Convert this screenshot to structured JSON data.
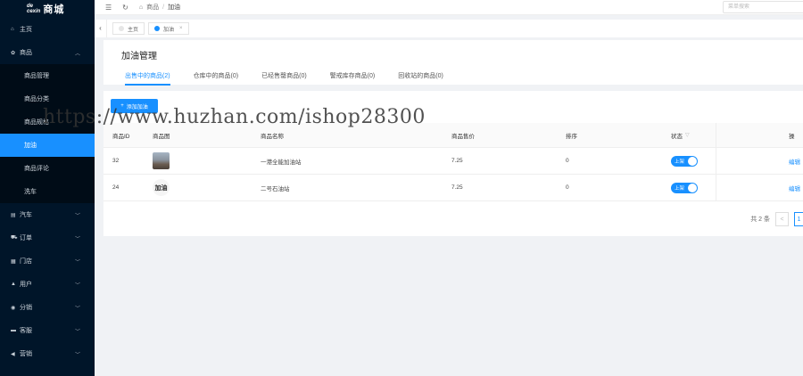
{
  "brand": {
    "mark_top": "de",
    "mark_bottom": "cexin",
    "name": "商城"
  },
  "sidebar": {
    "items": [
      {
        "icon": "home-icon",
        "glyph": "⌂",
        "label": "主页"
      },
      {
        "icon": "goods-icon",
        "glyph": "✿",
        "label": "商品",
        "open": true,
        "children": [
          "商品管理",
          "商品分类",
          "商品规格",
          "加油",
          "商品评论",
          "洗车"
        ],
        "active_child": 3
      },
      {
        "icon": "car-icon",
        "glyph": "▤",
        "label": "汽车"
      },
      {
        "icon": "cart-icon",
        "glyph": "⛟",
        "label": "订单"
      },
      {
        "icon": "store-icon",
        "glyph": "▦",
        "label": "门店"
      },
      {
        "icon": "user-icon",
        "glyph": "▲",
        "label": "用户"
      },
      {
        "icon": "share-icon",
        "glyph": "◉",
        "label": "分销"
      },
      {
        "icon": "chat-icon",
        "glyph": "▬",
        "label": "客服"
      },
      {
        "icon": "send-icon",
        "glyph": "◀",
        "label": "营销"
      }
    ]
  },
  "header": {
    "breadcrumb_root": "商品",
    "breadcrumb_current": "加油",
    "search_placeholder": "菜单搜索"
  },
  "tabs": [
    {
      "label": "主页",
      "active": false
    },
    {
      "label": "加油",
      "active": true
    }
  ],
  "page": {
    "title": "加油管理",
    "subtabs": [
      "出售中的商品(2)",
      "仓库中的商品(0)",
      "已经售罄商品(0)",
      "警戒库存商品(0)",
      "回收站的商品(0)"
    ],
    "active_subtab": 0,
    "add_button": "添加加油"
  },
  "table": {
    "columns": {
      "id": "商品ID",
      "image": "商品图",
      "name": "商品名称",
      "price": "商品售价",
      "sort": "排序",
      "status": "状态",
      "op": "操"
    },
    "rows": [
      {
        "id": "32",
        "image": "photo",
        "name": "一港全能加油站",
        "price": "7.25",
        "sort": "0",
        "status": "上架",
        "op": "编辑"
      },
      {
        "id": "24",
        "image": "加油",
        "name": "二号石油站",
        "price": "7.25",
        "sort": "0",
        "status": "上架",
        "op": "编辑"
      }
    ]
  },
  "pagination": {
    "total": "共 2 条",
    "prev": "<",
    "page": "1"
  },
  "watermark": "https://www.huzhan.com/ishop28300",
  "colors": {
    "primary": "#1890ff",
    "sidebar": "#001529"
  }
}
